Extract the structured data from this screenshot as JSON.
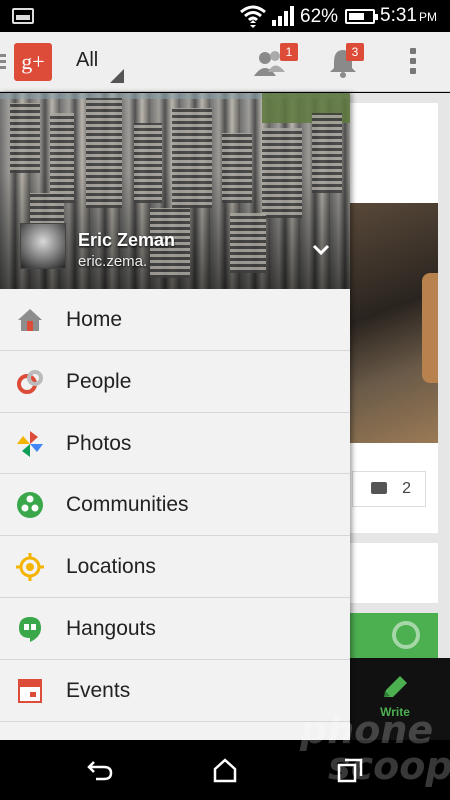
{
  "status_bar": {
    "battery_percent": "62%",
    "time": "5:31",
    "time_suffix": "PM",
    "icons": [
      "image-icon",
      "wifi-icon",
      "signal-icon",
      "battery-icon"
    ]
  },
  "action_bar": {
    "logo_text": "g+",
    "filter_label": "All",
    "people_badge": "1",
    "notifications_badge": "3",
    "colors": {
      "brand": "#dd4b39",
      "badge": "#dd4b39"
    }
  },
  "drawer": {
    "user": {
      "name": "Eric Zeman",
      "email": "eric.zema."
    },
    "items": [
      {
        "label": "Home",
        "icon": "home-icon"
      },
      {
        "label": "People",
        "icon": "people-icon"
      },
      {
        "label": "Photos",
        "icon": "photos-icon"
      },
      {
        "label": "Communities",
        "icon": "communities-icon"
      },
      {
        "label": "Locations",
        "icon": "locations-icon"
      },
      {
        "label": "Hangouts",
        "icon": "hangouts-icon"
      },
      {
        "label": "Events",
        "icon": "events-icon"
      }
    ]
  },
  "stream": {
    "comment_count": "2",
    "write_label": "Write",
    "colors": {
      "write": "#4caf50"
    }
  },
  "watermark": {
    "line1": "phone",
    "line2": "scoop"
  }
}
